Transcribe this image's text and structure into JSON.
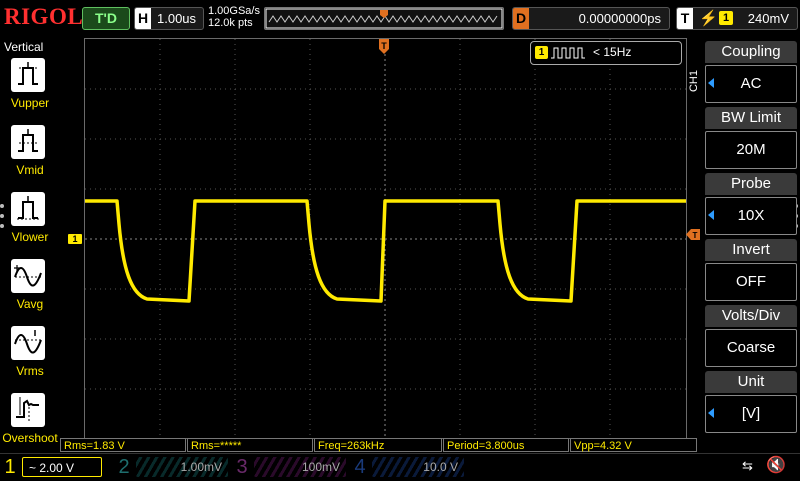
{
  "header": {
    "brand": "RIGOL",
    "run_status": "T'D",
    "horizontal": {
      "tag": "H",
      "value": "1.00us"
    },
    "sample_rate": "1.00GSa/s",
    "memory_depth": "12.0k pts",
    "delay": {
      "tag": "D",
      "value": "0.00000000ps"
    },
    "trigger": {
      "tag": "T",
      "edge_icon": "rising-edge-icon",
      "source": "1",
      "level": "240mV"
    }
  },
  "measure_panel": {
    "title": "Vertical",
    "items": [
      {
        "label": "Vupper",
        "icon": "vupper-icon"
      },
      {
        "label": "Vmid",
        "icon": "vmid-icon"
      },
      {
        "label": "Vlower",
        "icon": "vlower-icon"
      },
      {
        "label": "Vavg",
        "icon": "vavg-icon"
      },
      {
        "label": "Vrms",
        "icon": "vrms-icon"
      },
      {
        "label": "Overshoot",
        "icon": "overshoot-icon"
      }
    ]
  },
  "freq_counter": {
    "channel": "1",
    "text": "< 15Hz"
  },
  "channel_menu": {
    "tag": "CH1",
    "items": [
      {
        "title": "Coupling",
        "value": "AC",
        "has_arrow": true
      },
      {
        "title": "BW Limit",
        "value": "20M",
        "has_arrow": false
      },
      {
        "title": "Probe",
        "value": "10X",
        "has_arrow": true
      },
      {
        "title": "Invert",
        "value": "OFF",
        "has_arrow": false
      },
      {
        "title": "Volts/Div",
        "value": "Coarse",
        "has_arrow": false
      },
      {
        "title": "Unit",
        "value": "[V]",
        "has_arrow": true
      }
    ]
  },
  "measurements": [
    "Rms=1.83 V",
    "Rms=*****",
    "Freq=263kHz",
    "Period=3.800us",
    "Vpp=4.32 V"
  ],
  "channels": [
    {
      "num": "1",
      "scale": "~ 2.00 V"
    },
    {
      "num": "2",
      "scale": "1.00mV"
    },
    {
      "num": "3",
      "scale": "100mV"
    },
    {
      "num": "4",
      "scale": "10.0 V"
    }
  ],
  "markers": {
    "ch1_offset": "1",
    "trigger_pos": "T"
  },
  "colors": {
    "ch1": "#ffea00",
    "trigger": "#e07020",
    "brand": "#ff3030",
    "menu_arrow": "#2e9cff"
  }
}
